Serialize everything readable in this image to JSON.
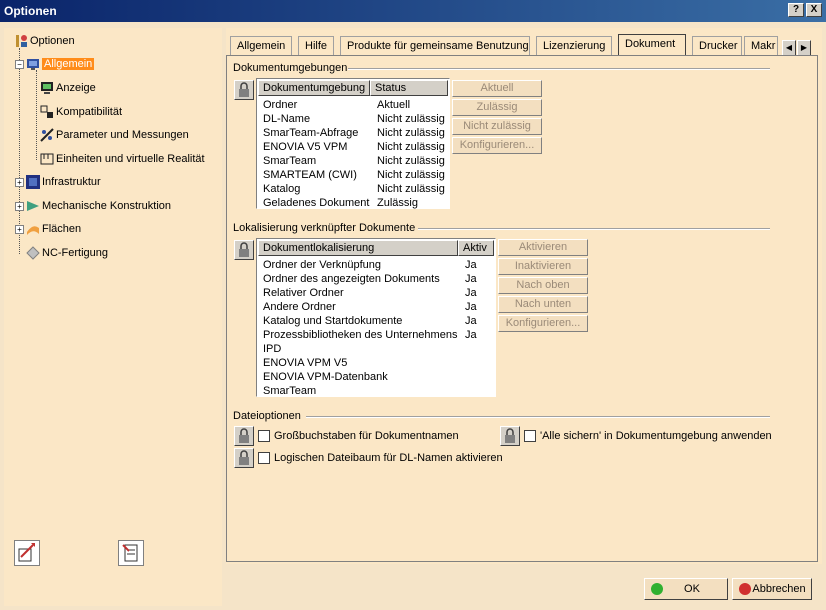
{
  "window": {
    "title": "Optionen",
    "help_btn": "?",
    "close_btn": "X"
  },
  "tree": {
    "root": "Optionen",
    "items": [
      {
        "label": "Allgemein"
      },
      {
        "label": "Anzeige"
      },
      {
        "label": "Kompatibilität"
      },
      {
        "label": "Parameter und Messungen"
      },
      {
        "label": "Einheiten und virtuelle Realität"
      },
      {
        "label": "Infrastruktur"
      },
      {
        "label": "Mechanische Konstruktion"
      },
      {
        "label": "Flächen"
      },
      {
        "label": "NC-Fertigung"
      }
    ]
  },
  "tabs": [
    {
      "label": "Allgemein"
    },
    {
      "label": "Hilfe"
    },
    {
      "label": "Produkte für gemeinsame Benutzung"
    },
    {
      "label": "Lizenzierung"
    },
    {
      "label": "Dokument"
    },
    {
      "label": "Drucker"
    },
    {
      "label": "Makr"
    }
  ],
  "doc_env": {
    "group_title": "Dokumentumgebungen",
    "col_env": "Dokumentumgebung",
    "col_status": "Status",
    "rows": [
      {
        "env": "Ordner",
        "status": "Aktuell"
      },
      {
        "env": "DL-Name",
        "status": "Nicht zulässig"
      },
      {
        "env": "SmarTeam-Abfrage",
        "status": "Nicht zulässig"
      },
      {
        "env": "ENOVIA V5 VPM",
        "status": "Nicht zulässig"
      },
      {
        "env": "SmarTeam",
        "status": "Nicht zulässig"
      },
      {
        "env": "SMARTEAM (CWI)",
        "status": "Nicht zulässig"
      },
      {
        "env": "Katalog",
        "status": "Nicht zulässig"
      },
      {
        "env": "Geladenes Dokument",
        "status": "Zulässig"
      }
    ],
    "buttons": [
      "Aktuell",
      "Zulässig",
      "Nicht zulässig",
      "Konfigurieren..."
    ]
  },
  "doc_loc": {
    "group_title": "Lokalisierung verknüpfter Dokumente",
    "col_loc": "Dokumentlokalisierung",
    "col_active": "Aktiv",
    "rows": [
      {
        "loc": "Ordner der Verknüpfung",
        "active": "Ja"
      },
      {
        "loc": "Ordner des angezeigten Dokuments",
        "active": "Ja"
      },
      {
        "loc": "Relativer Ordner",
        "active": "Ja"
      },
      {
        "loc": "Andere Ordner",
        "active": "Ja"
      },
      {
        "loc": "Katalog und Startdokumente",
        "active": "Ja"
      },
      {
        "loc": "Prozessbibliotheken des Unternehmens",
        "active": "Ja"
      },
      {
        "loc": "IPD",
        "active": ""
      },
      {
        "loc": "ENOVIA VPM V5",
        "active": ""
      },
      {
        "loc": "ENOVIA VPM-Datenbank",
        "active": ""
      },
      {
        "loc": "SmarTeam",
        "active": ""
      }
    ],
    "buttons": [
      "Aktivieren",
      "Inaktivieren",
      "Nach oben",
      "Nach unten",
      "Konfigurieren..."
    ]
  },
  "file_opts": {
    "group_title": "Dateioptionen",
    "opt_uppercase": "Großbuchstaben für Dokumentnamen",
    "opt_save_all": "'Alle sichern' in Dokumentumgebung anwenden",
    "opt_logical_tree": "Logischen Dateibaum für DL-Namen aktivieren"
  },
  "footer": {
    "ok": "OK",
    "cancel": "Abbrechen"
  }
}
